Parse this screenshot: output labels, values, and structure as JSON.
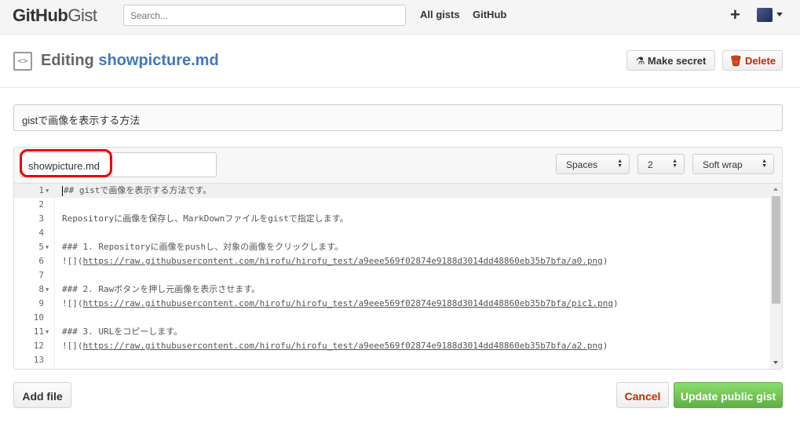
{
  "header": {
    "logo_bold": "GitHub",
    "logo_light": "Gist",
    "search_placeholder": "Search...",
    "nav": [
      "All gists",
      "GitHub"
    ],
    "new_icon": "+"
  },
  "titlebar": {
    "prefix": "Editing",
    "filename": "showpicture.md",
    "make_secret_label": "Make secret",
    "delete_label": "Delete"
  },
  "description": "gistで画像を表示する方法",
  "file": {
    "name": "showpicture.md",
    "indent_mode": "Spaces",
    "indent_size": "2",
    "wrap_mode": "Soft wrap",
    "lines": [
      {
        "num": "1",
        "fold": true,
        "text": "## gistで画像を表示する方法です。"
      },
      {
        "num": "2",
        "fold": false,
        "text": ""
      },
      {
        "num": "3",
        "fold": false,
        "text": "Repositoryに画像を保存し、MarkDownファイルをgistで指定します。"
      },
      {
        "num": "4",
        "fold": false,
        "text": ""
      },
      {
        "num": "5",
        "fold": true,
        "text": "### 1. Repositoryに画像をpushし、対象の画像をクリックします。"
      },
      {
        "num": "6",
        "fold": false,
        "text": "![](https://raw.githubusercontent.com/hirofu/hirofu_test/a9eee569f02874e9188d3014dd48860eb35b7bfa/a0.png)"
      },
      {
        "num": "7",
        "fold": false,
        "text": ""
      },
      {
        "num": "8",
        "fold": true,
        "text": "### 2. Rawボタンを押し元画像を表示させます。"
      },
      {
        "num": "9",
        "fold": false,
        "text": "![](https://raw.githubusercontent.com/hirofu/hirofu_test/a9eee569f02874e9188d3014dd48860eb35b7bfa/pic1.png)"
      },
      {
        "num": "10",
        "fold": false,
        "text": ""
      },
      {
        "num": "11",
        "fold": true,
        "text": "### 3. URLをコピーします。"
      },
      {
        "num": "12",
        "fold": false,
        "text": "![](https://raw.githubusercontent.com/hirofu/hirofu_test/a9eee569f02874e9188d3014dd48860eb35b7bfa/a2.png)"
      },
      {
        "num": "13",
        "fold": false,
        "text": ""
      }
    ]
  },
  "footer": {
    "add_file_label": "Add file",
    "cancel_label": "Cancel",
    "update_label": "Update public gist"
  },
  "colors": {
    "link_blue": "#4078c0",
    "danger_red": "#bd2c00",
    "update_green": "#60b044",
    "highlight_ring": "#ee0000"
  }
}
